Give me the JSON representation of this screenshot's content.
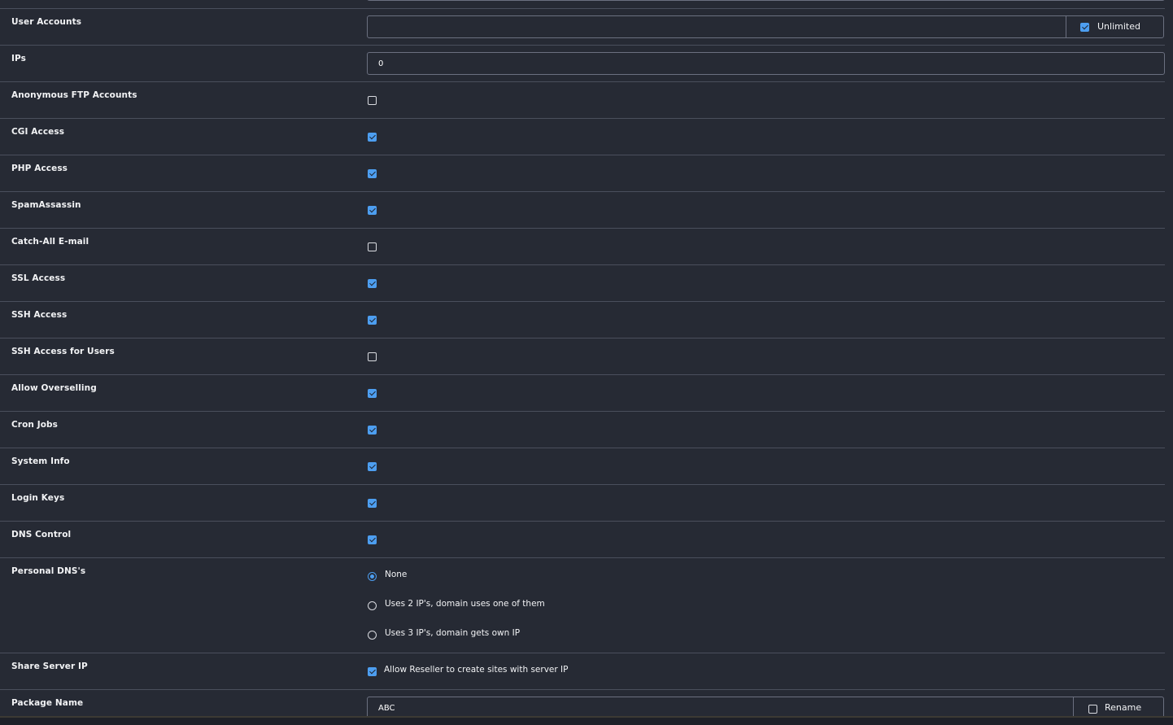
{
  "rows": {
    "user_accounts": {
      "label": "User Accounts",
      "value": "",
      "addon_label": "Unlimited",
      "addon_checked": true
    },
    "ips": {
      "label": "IPs",
      "value": "0"
    },
    "anon_ftp": {
      "label": "Anonymous FTP Accounts",
      "checked": false
    },
    "cgi": {
      "label": "CGI Access",
      "checked": true
    },
    "php": {
      "label": "PHP Access",
      "checked": true
    },
    "spamassassin": {
      "label": "SpamAssassin",
      "checked": true
    },
    "catchall": {
      "label": "Catch-All E-mail",
      "checked": false
    },
    "ssl": {
      "label": "SSL Access",
      "checked": true
    },
    "ssh": {
      "label": "SSH Access",
      "checked": true
    },
    "ssh_users": {
      "label": "SSH Access for Users",
      "checked": false
    },
    "overselling": {
      "label": "Allow Overselling",
      "checked": true
    },
    "cron": {
      "label": "Cron Jobs",
      "checked": true
    },
    "sysinfo": {
      "label": "System Info",
      "checked": true
    },
    "loginkeys": {
      "label": "Login Keys",
      "checked": true
    },
    "dns": {
      "label": "DNS Control",
      "checked": true
    },
    "personal_dns": {
      "label": "Personal DNS's",
      "options": [
        {
          "label": "None",
          "selected": true
        },
        {
          "label": "Uses 2 IP's, domain uses one of them",
          "selected": false
        },
        {
          "label": "Uses 3 IP's, domain gets own IP",
          "selected": false
        }
      ]
    },
    "share_ip": {
      "label": "Share Server IP",
      "checkbox_label": "Allow Reseller to create sites with server IP",
      "checked": true
    },
    "package_name": {
      "label": "Package Name",
      "value": "ABC",
      "addon_label": "Rename",
      "addon_checked": false
    }
  },
  "colors": {
    "background": "#262a34",
    "accent": "#4d9ef0",
    "divider": "#4a4f5c",
    "text": "#f2f3f5"
  }
}
